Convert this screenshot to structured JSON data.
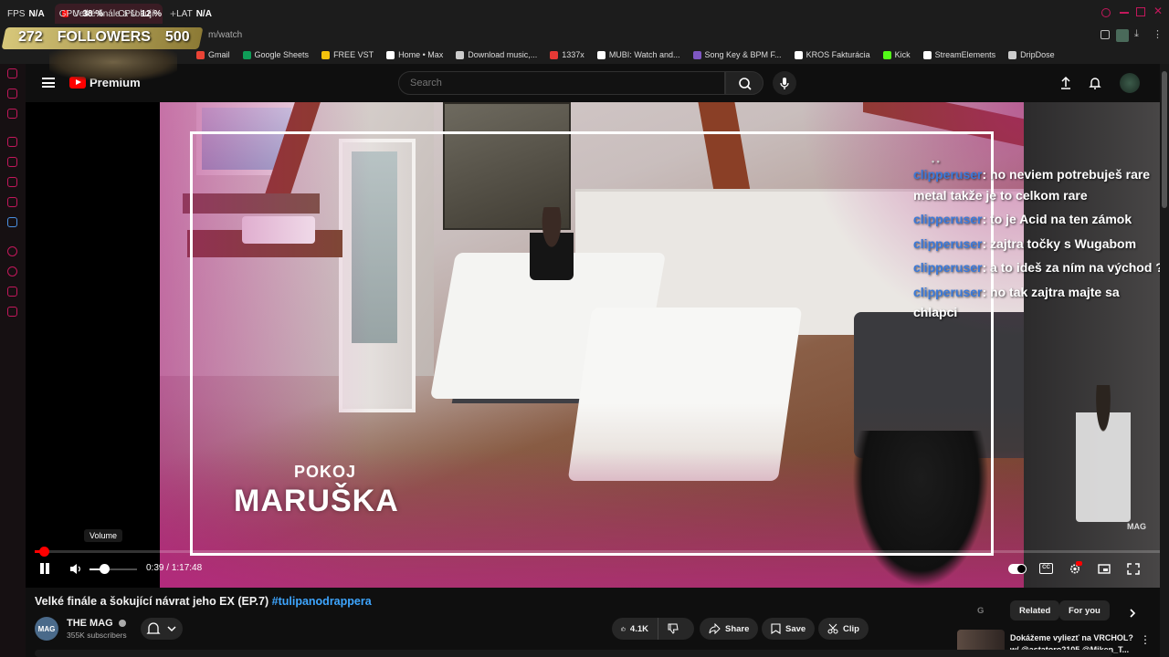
{
  "overlay": {
    "stats": [
      {
        "key": "FPS",
        "value": "N/A"
      },
      {
        "key": "GPU",
        "value": "38 %"
      },
      {
        "key": "CPU",
        "value": "12 %"
      },
      {
        "key": "LAT",
        "value": "N/A"
      }
    ],
    "followers_count": "272",
    "followers_label": "FOLLOWERS",
    "followers_goal": "500"
  },
  "browser": {
    "tab_title": "Velké finále a šokující",
    "address": "m/watch",
    "bookmarks": [
      {
        "label": "Gmail",
        "color": "#ea4335"
      },
      {
        "label": "Google Sheets",
        "color": "#0f9d58"
      },
      {
        "label": "FREE VST",
        "color": "#f4c20d"
      },
      {
        "label": "Home • Max",
        "color": "#ffffff"
      },
      {
        "label": "Download music,...",
        "color": "#cccccc"
      },
      {
        "label": "1337x",
        "color": "#e53935"
      },
      {
        "label": "MUBI: Watch and...",
        "color": "#ffffff"
      },
      {
        "label": "Song Key & BPM F...",
        "color": "#7e57c2"
      },
      {
        "label": "KROS Fakturácia",
        "color": "#ffffff"
      },
      {
        "label": "Kick",
        "color": "#53fc18"
      },
      {
        "label": "StreamElements",
        "color": "#ffffff"
      },
      {
        "label": "DripDose",
        "color": "#cccccc"
      }
    ]
  },
  "youtube": {
    "logo_text": "Premium",
    "search_placeholder": "Search"
  },
  "video": {
    "caption_small": "POKOJ",
    "caption_big": "MARUŠKA",
    "watermark": "MAG",
    "volume_tooltip": "Volume",
    "time_current": "0:39",
    "time_total": "1:17:48",
    "progress_fraction": 0.0084,
    "volume_fraction": 0.3
  },
  "chat": {
    "messages": [
      {
        "user": "clipperuser",
        "text": ": no neviem potrebuješ rare metal takže je to celkom rare"
      },
      {
        "user": "clipperuser",
        "text": ": to je Acid na ten zámok"
      },
      {
        "user": "clipperuser",
        "text": ": zajtra točky s Wugabom"
      },
      {
        "user": "clipperuser",
        "text": ": a to ideš za ním na východ ?"
      },
      {
        "user": "clipperuser",
        "text": ": no tak zajtra majte sa chlapci"
      }
    ]
  },
  "page": {
    "title": "Velké finále a šokující návrat jeho EX (EP.7)",
    "hashtag": "#tulipanodrappera",
    "channel_name": "THE MAG",
    "channel_avatar_text": "MAG",
    "subscribers": "355K subscribers",
    "likes": "4.1K",
    "share_label": "Share",
    "save_label": "Save",
    "clip_label": "Clip",
    "chips": [
      "G",
      "Related",
      "For you"
    ],
    "rec_title": "Dokážeme vyliezť na VRCHOL? w/ @astatoro2105 @Miken_T..."
  }
}
